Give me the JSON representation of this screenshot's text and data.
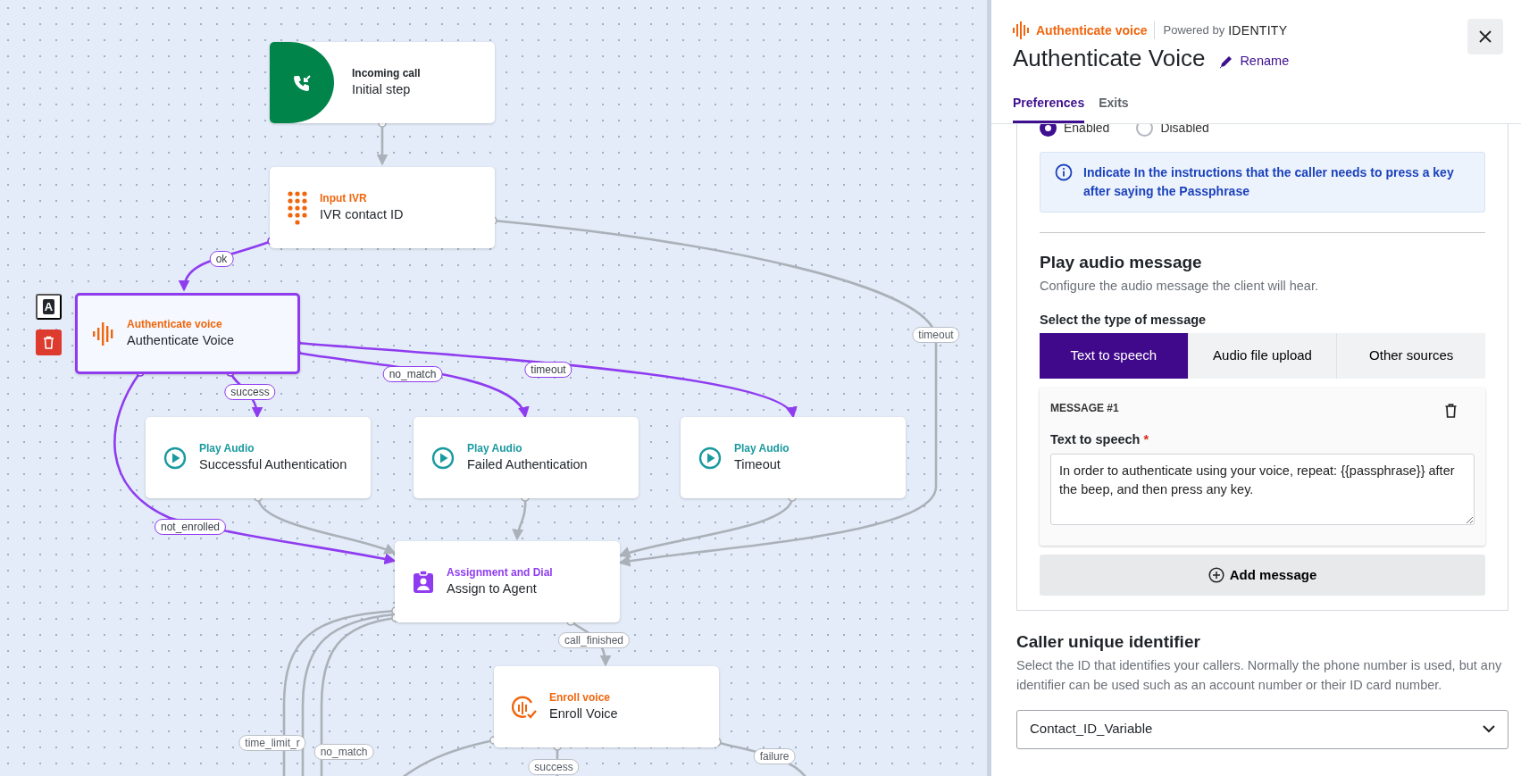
{
  "canvas": {
    "tools": {
      "label_button": "A"
    },
    "nodes": [
      {
        "kind": "call",
        "category": "Incoming call",
        "title": "Initial step",
        "selected": false
      },
      {
        "kind": "ivr",
        "category": "Input IVR",
        "title": "IVR contact ID",
        "selected": false
      },
      {
        "kind": "voice",
        "category": "Authenticate voice",
        "title": "Authenticate Voice",
        "selected": true
      },
      {
        "kind": "audio",
        "category": "Play Audio",
        "title": "Successful Authentication",
        "selected": false
      },
      {
        "kind": "audio",
        "category": "Play Audio",
        "title": "Failed Authentication",
        "selected": false
      },
      {
        "kind": "audio",
        "category": "Play Audio",
        "title": "Timeout",
        "selected": false
      },
      {
        "kind": "assign",
        "category": "Assignment and Dial",
        "title": "Assign to Agent",
        "selected": false
      },
      {
        "kind": "enroll",
        "category": "Enroll voice",
        "title": "Enroll Voice",
        "selected": false
      }
    ],
    "connections": [
      {
        "highlighted": false
      },
      {
        "label": "ok",
        "highlighted": true
      },
      {
        "label": "success",
        "highlighted": true
      },
      {
        "label": "no_match",
        "highlighted": true
      },
      {
        "label": "timeout",
        "highlighted": true
      },
      {
        "label": "not_enrolled",
        "highlighted": true
      },
      {
        "label": "timeout",
        "highlighted": false
      },
      {
        "highlighted": false
      },
      {
        "highlighted": false
      },
      {
        "highlighted": false
      },
      {
        "label": "call_finished",
        "highlighted": false
      },
      {
        "label": "time_limit_r",
        "highlighted": false
      },
      {
        "label": "no_match",
        "highlighted": false
      },
      {
        "highlighted": false
      },
      {
        "label": "success",
        "highlighted": false
      },
      {
        "label": "failure",
        "highlighted": false
      },
      {
        "highlighted": false
      }
    ]
  },
  "panel": {
    "badge": "Authenticate voice",
    "powered_by": "Powered by",
    "brand": "IDENTITY",
    "title": "Authenticate Voice",
    "rename": "Rename",
    "tabs": [
      {
        "label": "Preferences",
        "selected": true
      },
      {
        "label": "Exits",
        "selected": false
      }
    ],
    "options": [
      {
        "label": "Enabled",
        "selected": true
      },
      {
        "label": "Disabled",
        "selected": false
      }
    ],
    "info": "Indicate In the instructions that the caller needs to press a key after saying the Passphrase",
    "audio": {
      "heading": "Play audio message",
      "description": "Configure the audio message the client will hear.",
      "type_label": "Select the type of message",
      "types": [
        {
          "label": "Text to speech",
          "selected": true
        },
        {
          "label": "Audio file upload",
          "selected": false
        },
        {
          "label": "Other sources",
          "selected": false
        }
      ],
      "messages": [
        {
          "title": "MESSAGE #1",
          "field_label": "Text to speech",
          "required_mark": "*",
          "value": "In order to authenticate using your voice, repeat: {{passphrase}} after the beep, and then press any key."
        }
      ],
      "add_button": "Add message"
    },
    "caller": {
      "heading": "Caller unique identifier",
      "description": "Select the ID that identifies your callers. Normally the phone number is used, but any identifier can be used such as an account number or their ID card number.",
      "value": "Contact_ID_Variable"
    }
  }
}
